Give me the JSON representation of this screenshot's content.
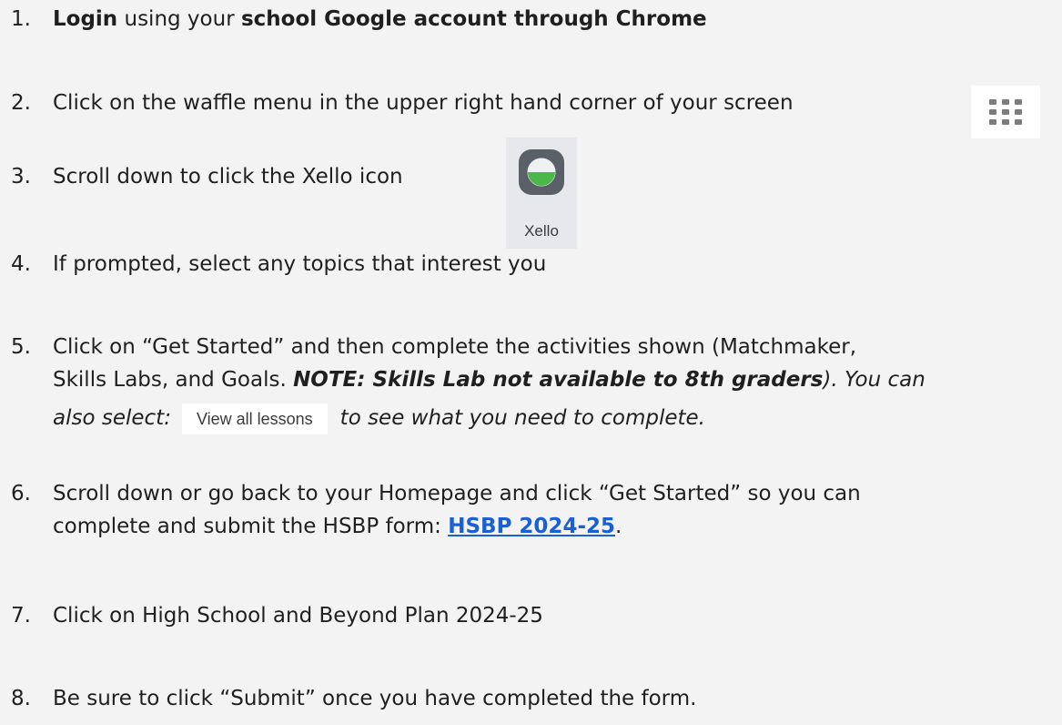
{
  "steps": [
    {
      "num": "1.",
      "parts": [
        {
          "text": "Login",
          "style": "bold"
        },
        {
          "text": " using your ",
          "style": "normal"
        },
        {
          "text": "school Google account through Chrome",
          "style": "bold"
        }
      ]
    },
    {
      "num": "2.",
      "text": "Click on the waffle menu in the upper right hand corner of your screen",
      "icon": "waffle-menu-icon"
    },
    {
      "num": "3.",
      "text": "Scroll down to click the Xello icon ",
      "icon": "xello-icon",
      "icon_label": "Xello"
    },
    {
      "num": "4.",
      "text": "If prompted, select any topics that interest you"
    },
    {
      "num": "5.",
      "line1": "Click on “Get Started” and then complete the activities shown (Matchmaker,",
      "line2_a": "Skills Labs, and Goals. ",
      "line2_note": "NOTE:  Skills Lab not available to 8th graders",
      "line2_b": ").",
      "line2_c": " You can",
      "line3_a": "also select:",
      "button_label": "View all lessons",
      "line3_b": "to see what  you need to complete."
    },
    {
      "num": "6.",
      "line1": "Scroll down or go back to your Homepage and click “Get Started” so you can",
      "line2_a": "complete and submit the HSBP form: ",
      "link_text": "HSBP 2024-25",
      "line2_b": "."
    },
    {
      "num": "7.",
      "text": "Click on High School and Beyond Plan 2024-25"
    },
    {
      "num": "8.",
      "text": "Be sure to click “Submit” once you have completed the form."
    }
  ],
  "colors": {
    "background": "#f3f3f3",
    "link": "#1a5fd6",
    "xello_green": "#4cb84a",
    "xello_dark": "#5a6068"
  }
}
